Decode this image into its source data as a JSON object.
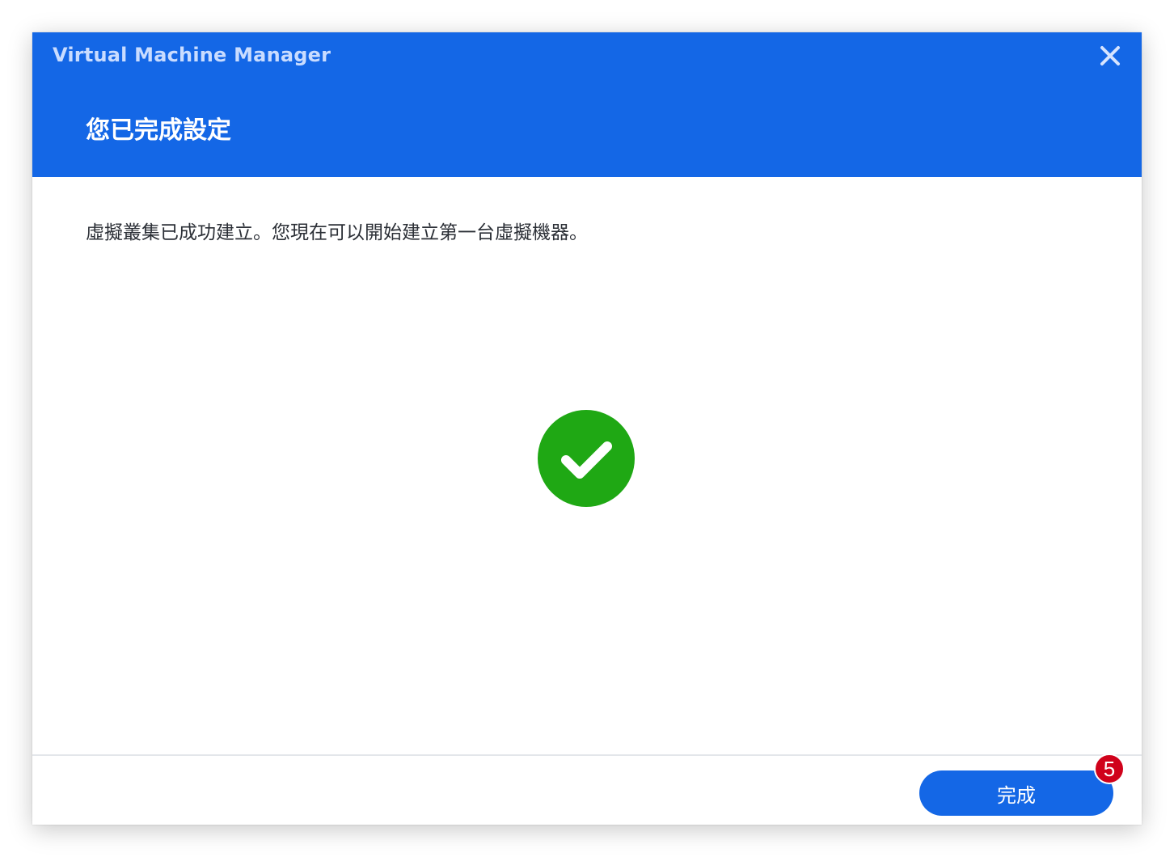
{
  "window": {
    "app_title": "Virtual Machine Manager",
    "close_icon": "close-icon"
  },
  "header": {
    "heading": "您已完成設定",
    "background_color": "#1467e6"
  },
  "main": {
    "message": "虛擬叢集已成功建立。您現在可以開始建立第一台虛擬機器。",
    "status_icon": "success-check-icon",
    "status_color": "#1fa814"
  },
  "footer": {
    "finish_label": "完成",
    "step_badge": "5",
    "badge_color": "#d0021b"
  }
}
